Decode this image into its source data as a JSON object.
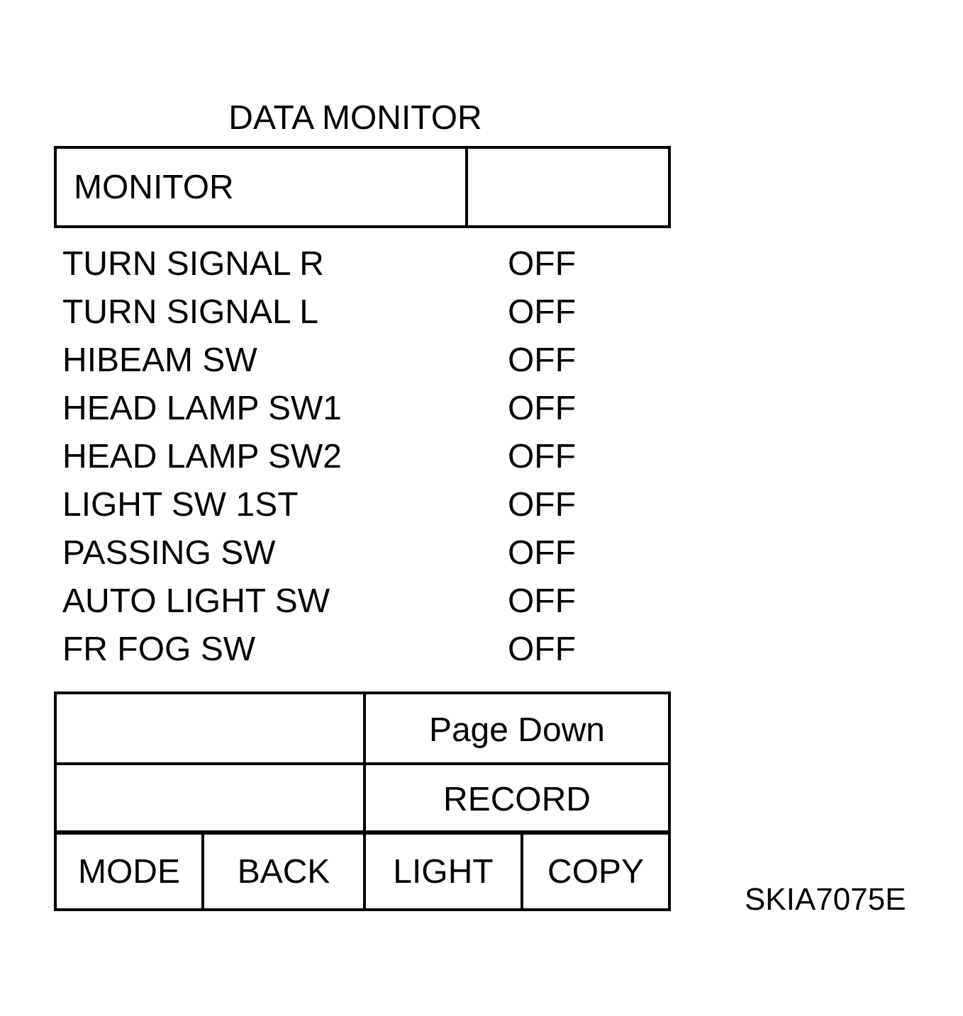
{
  "title": "DATA MONITOR",
  "header": {
    "label": "MONITOR"
  },
  "rows": [
    {
      "name": "TURN SIGNAL R",
      "value": "OFF"
    },
    {
      "name": "TURN SIGNAL L",
      "value": "OFF"
    },
    {
      "name": "HIBEAM SW",
      "value": "OFF"
    },
    {
      "name": "HEAD LAMP SW1",
      "value": "OFF"
    },
    {
      "name": "HEAD LAMP SW2",
      "value": "OFF"
    },
    {
      "name": "LIGHT SW 1ST",
      "value": "OFF"
    },
    {
      "name": "PASSING SW",
      "value": "OFF"
    },
    {
      "name": "AUTO LIGHT SW",
      "value": "OFF"
    },
    {
      "name": "FR FOG SW",
      "value": "OFF"
    }
  ],
  "panel": {
    "wide_buttons": [
      "Page Down",
      "RECORD"
    ],
    "buttons": [
      "MODE",
      "BACK",
      "LIGHT",
      "COPY"
    ]
  },
  "figure_code": "SKIA7075E"
}
